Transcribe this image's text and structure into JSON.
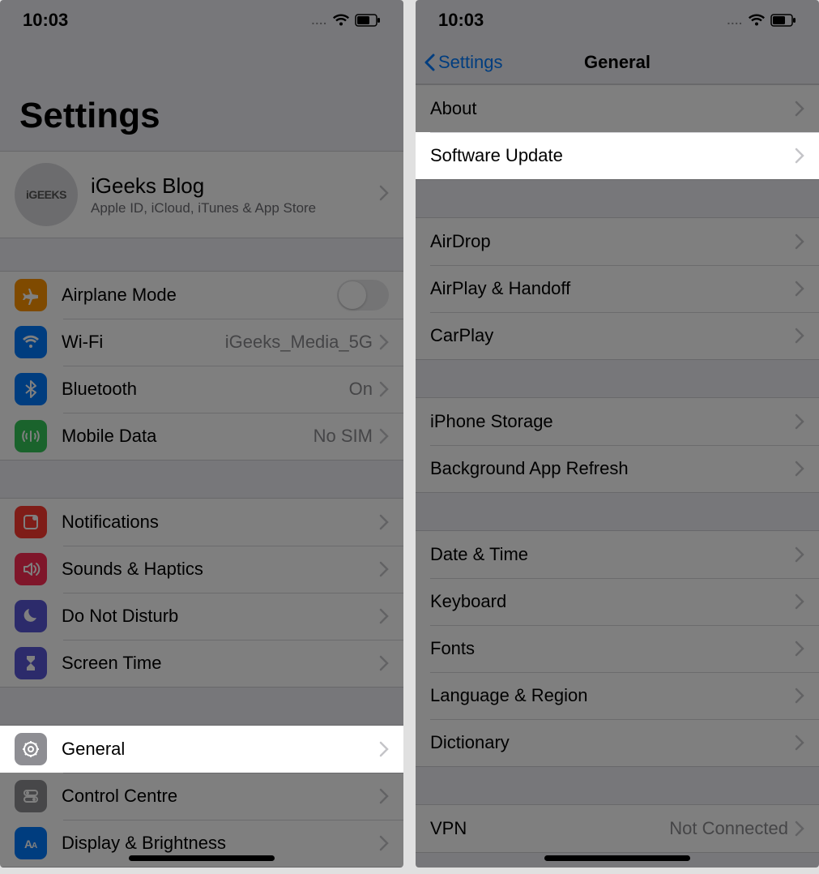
{
  "left": {
    "status": {
      "time": "10:03",
      "dots": "....",
      "wifi": true,
      "battery": 60
    },
    "title": "Settings",
    "account": {
      "avatar_text": "iGEEKS",
      "name": "iGeeks Blog",
      "subtitle": "Apple ID, iCloud, iTunes & App Store"
    },
    "g1": {
      "airplane": "Airplane Mode",
      "wifi": "Wi-Fi",
      "wifi_value": "iGeeks_Media_5G",
      "bluetooth": "Bluetooth",
      "bluetooth_value": "On",
      "mobile": "Mobile Data",
      "mobile_value": "No SIM"
    },
    "g2": {
      "notifications": "Notifications",
      "sounds": "Sounds & Haptics",
      "dnd": "Do Not Disturb",
      "screentime": "Screen Time"
    },
    "g3": {
      "general": "General",
      "control": "Control Centre",
      "display": "Display & Brightness"
    }
  },
  "right": {
    "status": {
      "time": "10:03",
      "dots": "....",
      "wifi": true,
      "battery": 60
    },
    "nav": {
      "back": "Settings",
      "title": "General"
    },
    "g1": {
      "about": "About",
      "software": "Software Update"
    },
    "g2": {
      "airdrop": "AirDrop",
      "airplay": "AirPlay & Handoff",
      "carplay": "CarPlay"
    },
    "g3": {
      "storage": "iPhone Storage",
      "bg": "Background App Refresh"
    },
    "g4": {
      "date": "Date & Time",
      "keyboard": "Keyboard",
      "fonts": "Fonts",
      "lang": "Language & Region",
      "dict": "Dictionary"
    },
    "g5": {
      "vpn": "VPN",
      "vpn_value": "Not Connected"
    }
  }
}
